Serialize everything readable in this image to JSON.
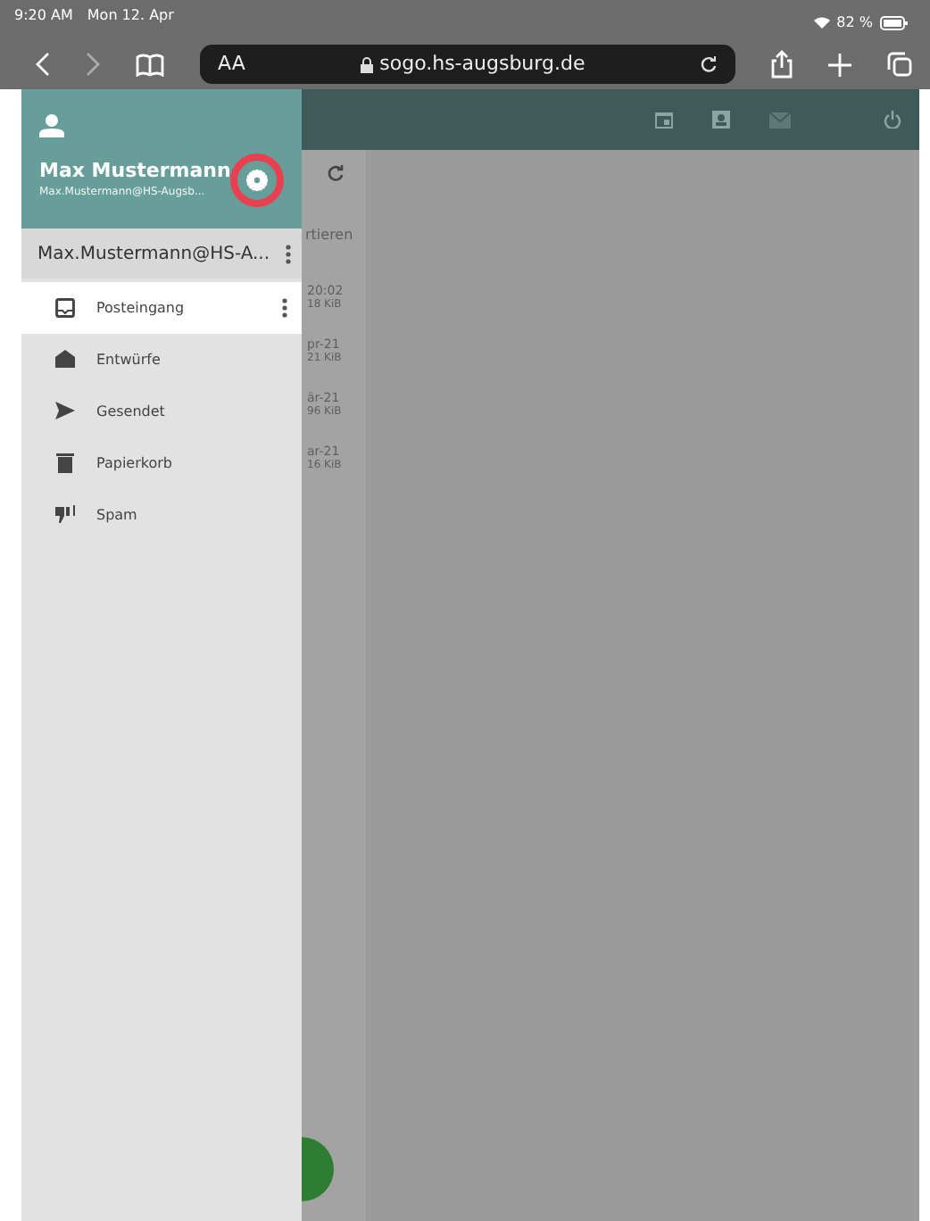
{
  "status_bar": {
    "time": "9:20 AM",
    "date": "Mon 12. Apr",
    "battery": "82 %"
  },
  "browser": {
    "text_size": "AA",
    "address": "sogo.hs-augsburg.de"
  },
  "drawer": {
    "user_name": "Max Mustermann",
    "user_email": "Max.Mustermann@HS-Augsb...",
    "account": "Max.Mustermann@HS-A...",
    "folders": [
      {
        "label": "Posteingang",
        "kind": "inbox",
        "selected": true
      },
      {
        "label": "Entwürfe",
        "kind": "drafts",
        "selected": false
      },
      {
        "label": "Gesendet",
        "kind": "sent",
        "selected": false
      },
      {
        "label": "Papierkorb",
        "kind": "trash",
        "selected": false
      },
      {
        "label": "Spam",
        "kind": "spam",
        "selected": false
      }
    ]
  },
  "background_list": {
    "sort_label": "rtieren",
    "messages": [
      {
        "date": "20:02",
        "size": "18 KiB"
      },
      {
        "date": "pr-21",
        "size": "21 KiB"
      },
      {
        "date": "är-21",
        "size": "96 KiB"
      },
      {
        "date": "ar-21",
        "size": "16 KiB"
      }
    ]
  }
}
